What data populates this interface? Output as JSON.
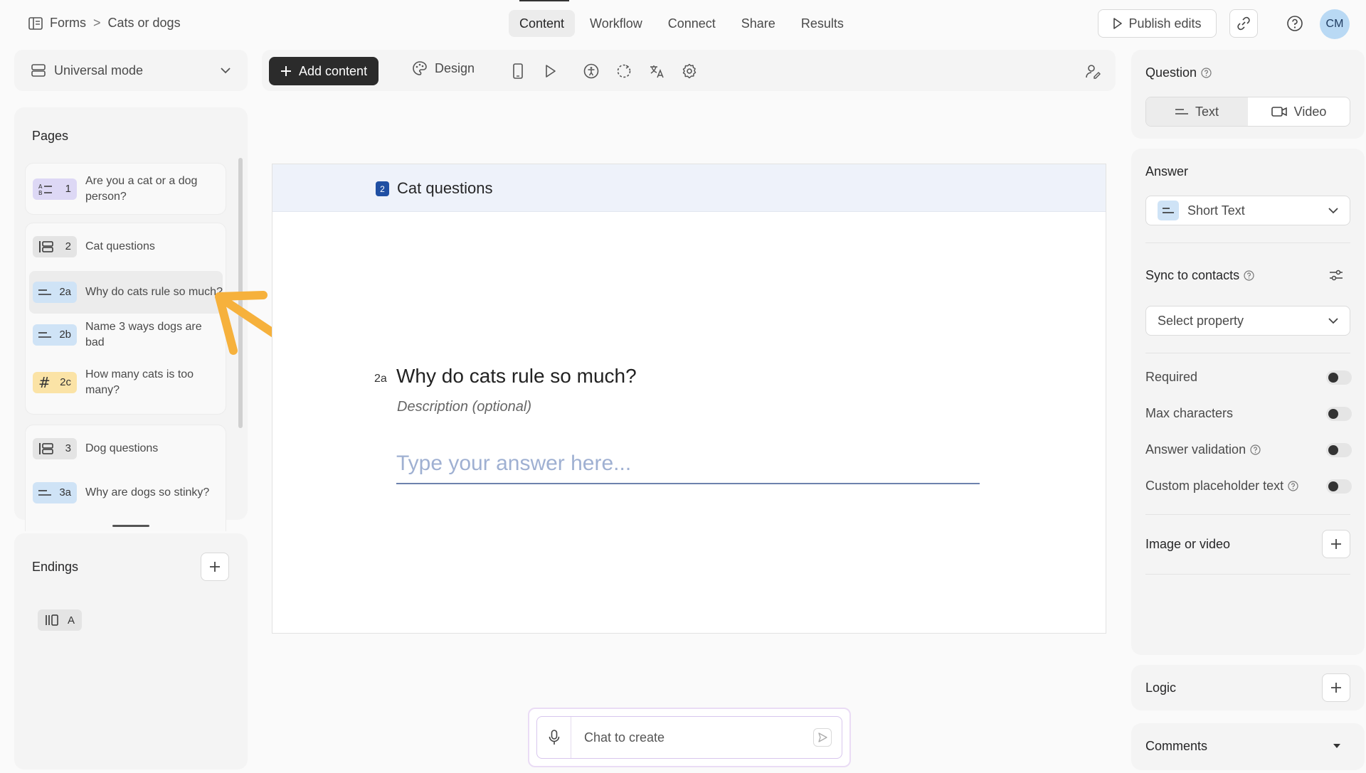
{
  "breadcrumb": {
    "root": "Forms",
    "separator": ">",
    "current": "Cats or dogs"
  },
  "tabs": [
    {
      "label": "Content",
      "active": true
    },
    {
      "label": "Workflow"
    },
    {
      "label": "Connect"
    },
    {
      "label": "Share"
    },
    {
      "label": "Results"
    }
  ],
  "header_actions": {
    "publish_label": "Publish edits",
    "avatar_initials": "CM"
  },
  "mode_select": {
    "label": "Universal mode"
  },
  "toolbar": {
    "add_content_label": "Add content",
    "design_label": "Design"
  },
  "pages": {
    "title": "Pages",
    "items": [
      {
        "badge": "1",
        "label": "Are you a cat or a dog person?",
        "icon": "ranking-icon"
      },
      {
        "badge": "2",
        "label": "Cat questions",
        "icon": "group-icon"
      },
      {
        "badge": "2a",
        "label": "Why do cats rule so much?",
        "icon": "short-text-icon",
        "selected": true
      },
      {
        "badge": "2b",
        "label": "Name 3 ways dogs are bad",
        "icon": "short-text-icon"
      },
      {
        "badge": "2c",
        "label": "How many cats is too many?",
        "icon": "number-icon"
      },
      {
        "badge": "3",
        "label": "Dog questions",
        "icon": "group-icon"
      },
      {
        "badge": "3a",
        "label": "Why are dogs so stinky?",
        "icon": "short-text-icon"
      }
    ]
  },
  "endings": {
    "title": "Endings",
    "items": [
      {
        "badge": "A",
        "icon": "ending-icon"
      }
    ]
  },
  "canvas": {
    "group_number": "2",
    "group_title": "Cat questions",
    "question_number": "2a",
    "question_title": "Why do cats rule so much?",
    "description_placeholder": "Description (optional)",
    "answer_placeholder": "Type your answer here..."
  },
  "chat": {
    "placeholder": "Chat to create"
  },
  "right_panel": {
    "question_label": "Question",
    "question_types": [
      "Text",
      "Video"
    ],
    "answer_label": "Answer",
    "answer_type": "Short Text",
    "sync_label": "Sync to contacts",
    "select_property": "Select property",
    "toggles": [
      {
        "label": "Required",
        "on": false
      },
      {
        "label": "Max characters",
        "on": false
      },
      {
        "label": "Answer validation",
        "on": false
      },
      {
        "label": "Custom placeholder text",
        "on": false
      }
    ],
    "image_video_label": "Image or video",
    "logic_label": "Logic",
    "comments_label": "Comments"
  },
  "colors": {
    "accent_dark": "#2b2b2b",
    "group_badge": "#1f4fa3",
    "arrow": "#f6b13c"
  }
}
